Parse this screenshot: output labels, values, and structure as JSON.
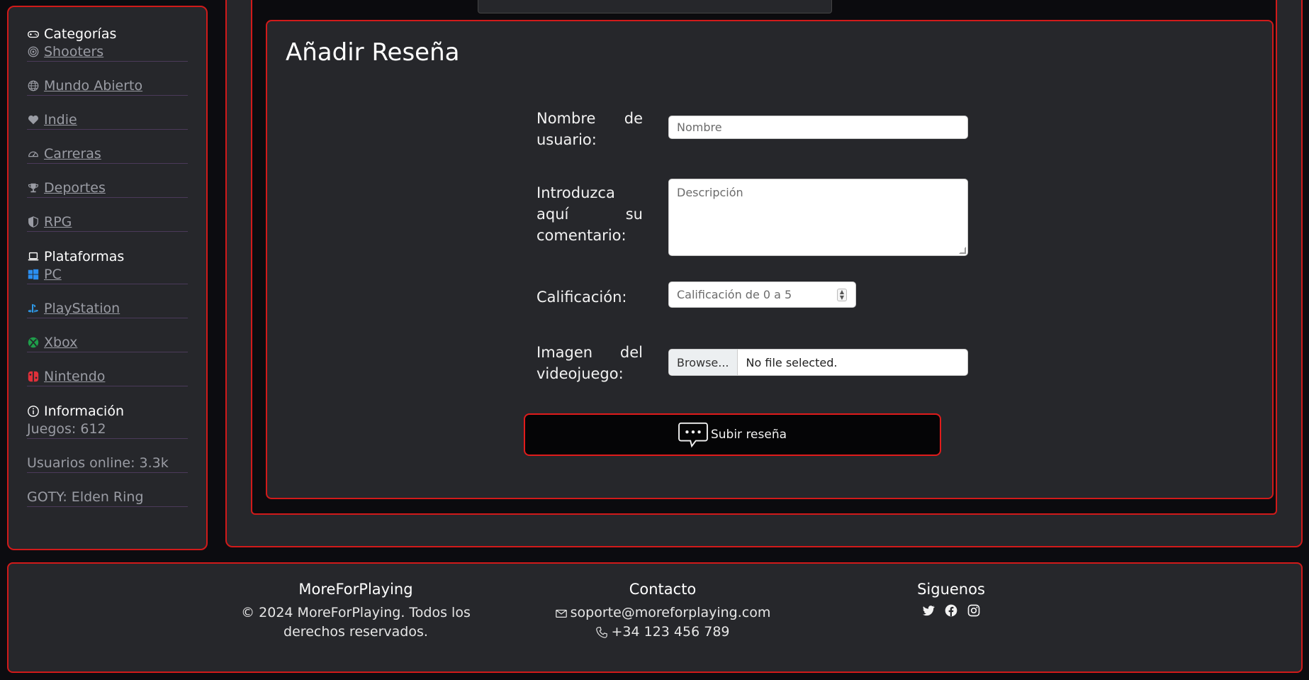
{
  "sidebar": {
    "categories_heading": "Categorías",
    "categories": [
      {
        "label": "Shooters",
        "icon": "target-icon"
      },
      {
        "label": "Mundo Abierto",
        "icon": "globe-icon"
      },
      {
        "label": "Indie",
        "icon": "heart-icon"
      },
      {
        "label": "Carreras",
        "icon": "speedometer-icon"
      },
      {
        "label": "Deportes",
        "icon": "trophy-icon"
      },
      {
        "label": "RPG",
        "icon": "shield-icon"
      }
    ],
    "platforms_heading": "Plataformas",
    "platforms": [
      {
        "label": "PC",
        "icon": "windows-icon",
        "color": "#2b8ef0"
      },
      {
        "label": "PlayStation",
        "icon": "playstation-icon",
        "color": "#2fa7ff"
      },
      {
        "label": "Xbox",
        "icon": "xbox-icon",
        "color": "#1e9e4a"
      },
      {
        "label": "Nintendo",
        "icon": "nintendo-switch-icon",
        "color": "#e0303a"
      }
    ],
    "info_heading": "Información",
    "info": [
      "Juegos: 612",
      "Usuarios online: 3.3k",
      "GOTY: Elden Ring"
    ]
  },
  "form": {
    "title": "Añadir Reseña",
    "username_label": "Nombre de usuario:",
    "username_placeholder": "Nombre",
    "comment_label": "Introduzca aquí su comentario:",
    "comment_placeholder": "Descripción",
    "rating_label": "Calificación:",
    "rating_placeholder": "Calificación de 0 a 5",
    "image_label": "Imagen del videojuego:",
    "browse_label": "Browse...",
    "file_status": "No file selected.",
    "submit_label": "Subir reseña"
  },
  "footer": {
    "brand_title": "MoreForPlaying",
    "copyright_line1": "© 2024 MoreForPlaying. Todos los",
    "copyright_line2": "derechos reservados.",
    "contact_title": "Contacto",
    "email": "soporte@moreforplaying.com",
    "phone": "+34 123 456 789",
    "social_title": "Siguenos",
    "social": [
      "twitter-icon",
      "facebook-icon",
      "instagram-icon"
    ]
  },
  "colors": {
    "accent": "#d11a1a",
    "panel": "#26272b",
    "background": "#0c0c10"
  }
}
